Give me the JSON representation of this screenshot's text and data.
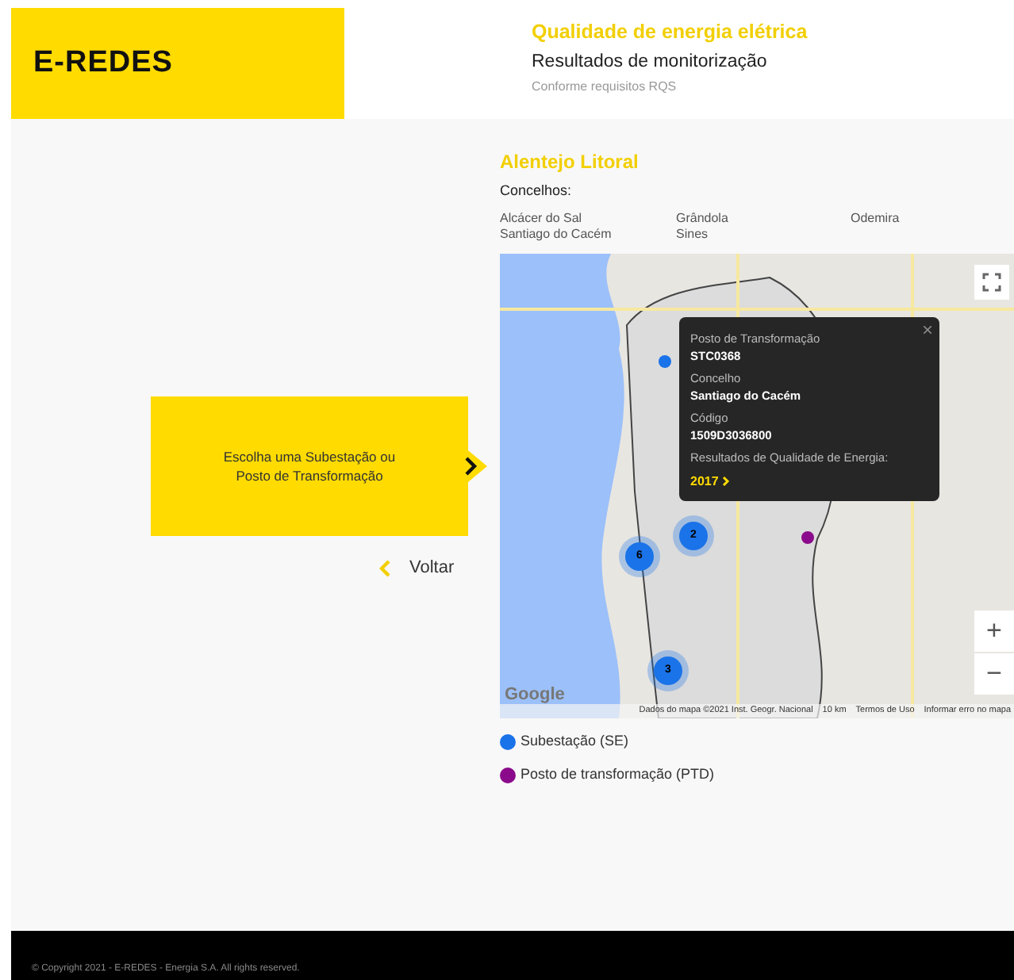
{
  "header": {
    "logo": "E-REDES",
    "title": "Qualidade de energia elétrica",
    "subtitle": "Resultados de monitorização",
    "note": "Conforme requisitos RQS"
  },
  "chooser": {
    "label": "Escolha uma Subestação ou Posto de Transformação",
    "back": "Voltar"
  },
  "region": {
    "title": "Alentejo Litoral",
    "concelhos_label": "Concelhos:",
    "concelhos": [
      "Alcácer do Sal",
      "Grândola",
      "Odemira",
      "Santiago do Cacém",
      "Sines"
    ]
  },
  "map": {
    "popup": {
      "fields": [
        {
          "label": "Posto de Transformação",
          "value": "STC0368"
        },
        {
          "label": "Concelho",
          "value": "Santiago do Cacém"
        },
        {
          "label": "Código",
          "value": "1509D3036800"
        }
      ],
      "results_label": "Resultados de Qualidade de Energia:",
      "link": "2017",
      "close": "×"
    },
    "clusters": [
      "2",
      "6",
      "3"
    ],
    "zoom_in": "+",
    "zoom_out": "−",
    "logo": "Google",
    "attribution": "Dados do mapa ©2021 Inst. Geogr. Nacional",
    "scale": "10 km",
    "terms": "Termos de Uso",
    "report": "Informar erro no mapa"
  },
  "legend": [
    {
      "label": "Subestação (SE)",
      "color": "#1a73e8"
    },
    {
      "label": "Posto de transformação (PTD)",
      "color": "#8b0a8b"
    }
  ],
  "footer": "© Copyright 2021 - E-REDES - Energia S.A. All rights reserved."
}
